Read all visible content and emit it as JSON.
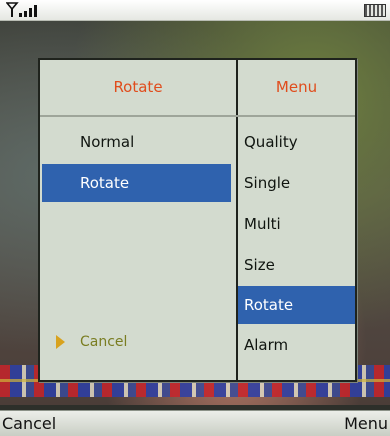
{
  "status": {
    "signal_icon": "signal-strength-icon",
    "battery_icon": "battery-icon"
  },
  "popup": {
    "left_title": "Rotate",
    "right_title": "Menu",
    "left_items": [
      {
        "label": "Normal",
        "selected": false
      },
      {
        "label": "Rotate",
        "selected": true
      }
    ],
    "right_items": [
      {
        "label": "Quality",
        "selected": false
      },
      {
        "label": "Single",
        "selected": false
      },
      {
        "label": "Multi",
        "selected": false
      },
      {
        "label": "Size",
        "selected": false
      },
      {
        "label": "Rotate",
        "selected": true
      },
      {
        "label": "Alarm",
        "selected": false
      }
    ],
    "cancel_label": "Cancel",
    "selection_color": "#2f62ae",
    "title_color": "#e04c1c"
  },
  "softkeys": {
    "left": "Cancel",
    "right": "Menu"
  }
}
